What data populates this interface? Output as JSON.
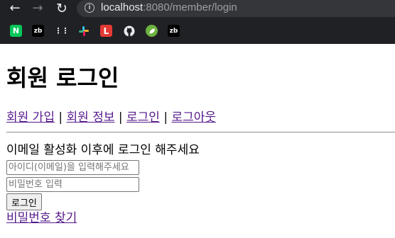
{
  "browser": {
    "url_host": "localhost",
    "url_rest": ":8080/member/login",
    "bookmarks": {
      "naver": "N",
      "zb1": "zb",
      "l": "L",
      "zb2": "zb"
    },
    "bookmark_icons": [
      "naver-icon",
      "zb-icon",
      "dots-icon",
      "slack-icon",
      "l-icon",
      "github-icon",
      "spring-icon",
      "zb-icon"
    ]
  },
  "page": {
    "title": "회원 로그인",
    "nav": {
      "signup": "회원 가입",
      "info": "회원 정보",
      "login": "로그인",
      "logout": "로그아웃",
      "separator": " | "
    },
    "notice": "이메일 활성화 이후에 로그인 해주세요",
    "email_placeholder": "아이디(이메일)을 입력해주세요",
    "password_placeholder": "비밀번호 입력",
    "login_button": "로그인",
    "find_password_link": "비밀번호 찾기"
  },
  "colors": {
    "chrome_bg": "#202124",
    "visited_link": "#551a8b"
  }
}
